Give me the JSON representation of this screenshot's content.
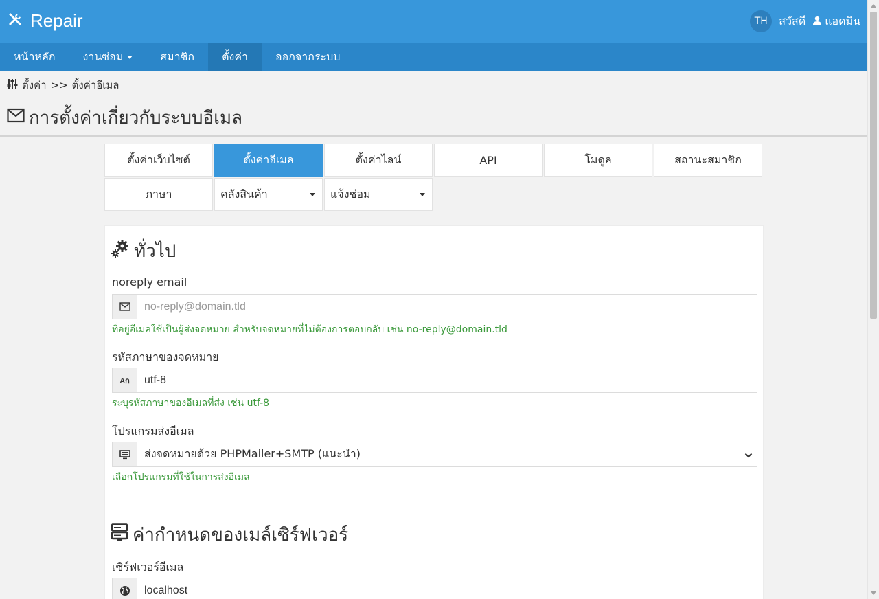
{
  "app": {
    "brand": "Repair",
    "avatar_initials": "TH",
    "greeting": "สวัสดี",
    "user_name": "แอดมิน"
  },
  "nav": [
    {
      "label": "หน้าหลัก"
    },
    {
      "label": "งานซ่อม",
      "has_dropdown": true
    },
    {
      "label": "สมาชิก"
    },
    {
      "label": "ตั้งค่า",
      "active": true
    },
    {
      "label": "ออกจากระบบ"
    }
  ],
  "breadcrumb": {
    "parent": "ตั้งค่า",
    "separator": ">>",
    "current": "ตั้งค่าอีเมล"
  },
  "page_title": "การตั้งค่าเกี่ยวกับระบบอีเมล",
  "tabs": [
    {
      "label": "ตั้งค่าเว็บไซต์"
    },
    {
      "label": "ตั้งค่าอีเมล",
      "active": true
    },
    {
      "label": "ตั้งค่าไลน์"
    },
    {
      "label": "API"
    },
    {
      "label": "โมดูล"
    },
    {
      "label": "สถานะสมาชิก"
    },
    {
      "label": "ภาษา"
    },
    {
      "label": "คลังสินค้า",
      "has_dropdown": true
    },
    {
      "label": "แจ้งซ่อม",
      "has_dropdown": true
    }
  ],
  "general": {
    "title": "ทั่วไป",
    "noreply_label": "noreply email",
    "noreply_placeholder": "no-reply@domain.tld",
    "noreply_hint": "ที่อยู่อีเมลใช้เป็นผู้ส่งจดหมาย สำหรับจดหมายที่ไม่ต้องการตอบกลับ เช่น no-reply@domain.tld",
    "charset_label": "รหัสภาษาของจดหมาย",
    "charset_value": "utf-8",
    "charset_hint": "ระบุรหัสภาษาของอีเมลที่ส่ง เช่น utf-8",
    "program_label": "โปรแกรมส่งอีเมล",
    "program_value": "ส่งจดหมายด้วย PHPMailer+SMTP (แนะนำ)",
    "program_hint": "เลือกโปรแกรมที่ใช้ในการส่งอีเมล"
  },
  "server": {
    "title": "ค่ากำหนดของเมล์เซิร์ฟเวอร์",
    "host_label": "เซิร์ฟเวอร์อีเมล",
    "host_value": "localhost"
  },
  "colors": {
    "topbar": "#3897db",
    "navbar": "#2b86c9",
    "active_tab": "#3897db",
    "hint": "#3c9a3c"
  }
}
